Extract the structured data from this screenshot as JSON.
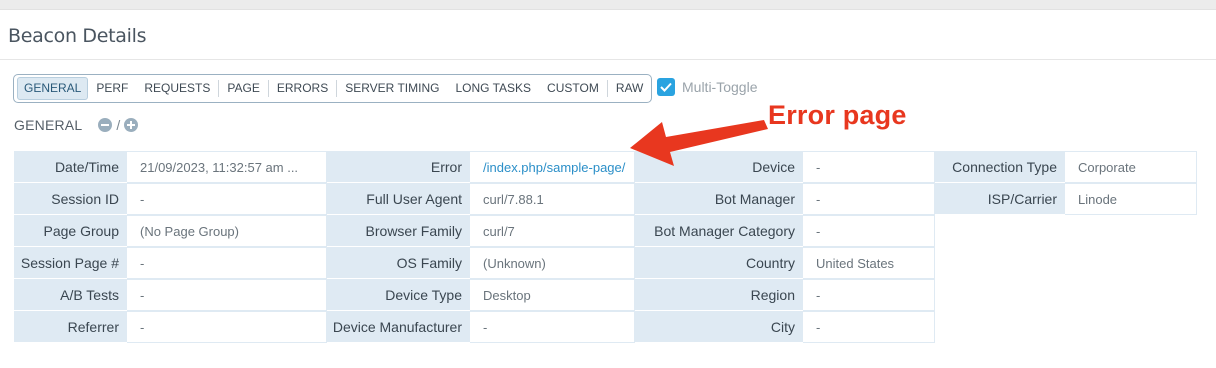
{
  "panel": {
    "title": "Beacon Details"
  },
  "tabs": [
    {
      "label": "GENERAL",
      "active": true
    },
    {
      "label": "PERF"
    },
    {
      "label": "REQUESTS"
    },
    {
      "label": "PAGE"
    },
    {
      "label": "ERRORS"
    },
    {
      "label": "SERVER TIMING"
    },
    {
      "label": "LONG TASKS"
    },
    {
      "label": "CUSTOM"
    },
    {
      "label": "RAW"
    }
  ],
  "multi_toggle": {
    "label": "Multi-Toggle",
    "checked": true
  },
  "section": {
    "label": "GENERAL",
    "separator": "/"
  },
  "annotation": {
    "text": "Error page",
    "color": "#e8371f"
  },
  "columns": [
    {
      "rows": [
        {
          "label": "Date/Time",
          "value": "21/09/2023, 11:32:57 am ..."
        },
        {
          "label": "Session ID",
          "value": "-"
        },
        {
          "label": "Page Group",
          "value": "(No Page Group)"
        },
        {
          "label": "Session Page #",
          "value": "-"
        },
        {
          "label": "A/B Tests",
          "value": "-"
        },
        {
          "label": "Referrer",
          "value": "-"
        }
      ]
    },
    {
      "rows": [
        {
          "label": "Error",
          "value": "/index.php/sample-page/",
          "link": true
        },
        {
          "label": "Full User Agent",
          "value": "curl/7.88.1"
        },
        {
          "label": "Browser Family",
          "value": "curl/7"
        },
        {
          "label": "OS Family",
          "value": "(Unknown)"
        },
        {
          "label": "Device Type",
          "value": "Desktop"
        },
        {
          "label": "Device Manufacturer",
          "value": "-"
        }
      ]
    },
    {
      "rows": [
        {
          "label": "Device",
          "value": "-"
        },
        {
          "label": "Bot Manager",
          "value": "-"
        },
        {
          "label": "Bot Manager Category",
          "value": "-"
        },
        {
          "label": "Country",
          "value": "United States"
        },
        {
          "label": "Region",
          "value": "-"
        },
        {
          "label": "City",
          "value": "-"
        }
      ]
    },
    {
      "rows": [
        {
          "label": "Connection Type",
          "value": "Corporate"
        },
        {
          "label": "ISP/Carrier",
          "value": "Linode"
        }
      ]
    }
  ],
  "colors": {
    "accent": "#2aa3e0",
    "label_bg": "#dfeaf3",
    "link": "#2b8fc8"
  }
}
